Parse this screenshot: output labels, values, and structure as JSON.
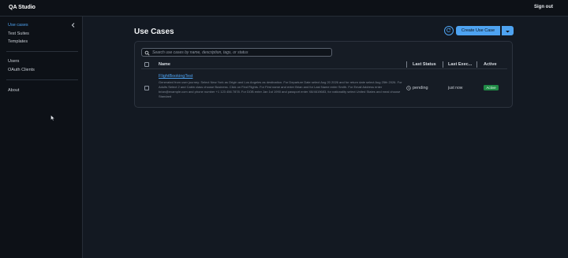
{
  "app": {
    "title": "QA Studio",
    "sign_out_label": "Sign out"
  },
  "sidebar": {
    "collapse_icon": "chevron-left-icon",
    "items": [
      {
        "label": "Use cases",
        "active": true
      },
      {
        "label": "Test Suites",
        "active": false
      },
      {
        "label": "Templates",
        "active": false
      },
      {
        "label": "Users",
        "active": false
      },
      {
        "label": "OAuth Clients",
        "active": false
      },
      {
        "label": "About",
        "active": false
      }
    ]
  },
  "main": {
    "title": "Use Cases",
    "refresh_icon": "refresh-icon",
    "create_label": "Create Use Case",
    "create_menu_icon": "caret-down-icon",
    "search": {
      "placeholder": "Search use cases by name, description, tags, or status",
      "value": ""
    },
    "columns": [
      "Name",
      "Last Status",
      "Last Exec...",
      "Active"
    ],
    "rows": [
      {
        "name": "FlightBookingTest",
        "description": "Generated from user journey: Select New York as Origin and Los Angeles as destination. For Departure Date select Aug 20 2026 and for return date select Aug 25th 2026. For Adults Select 2 and Cabin class choose Business. Click on Find Flights. For First name and enter Brian and for Last Name enter Smith. For Email Address enter brian@example.com and phone number +1 123 456 7878. For DOB enter Jan 1st 1990 and passport enter X8/4619683, for nationality select United States and meal choose Standard",
        "last_status": "pending",
        "last_executed": "just now",
        "active": "Active"
      }
    ]
  },
  "colors": {
    "accent": "#4ea3f1",
    "background": "#131922",
    "sidebar": "#0d1117",
    "active_badge": "#1f8a45"
  }
}
